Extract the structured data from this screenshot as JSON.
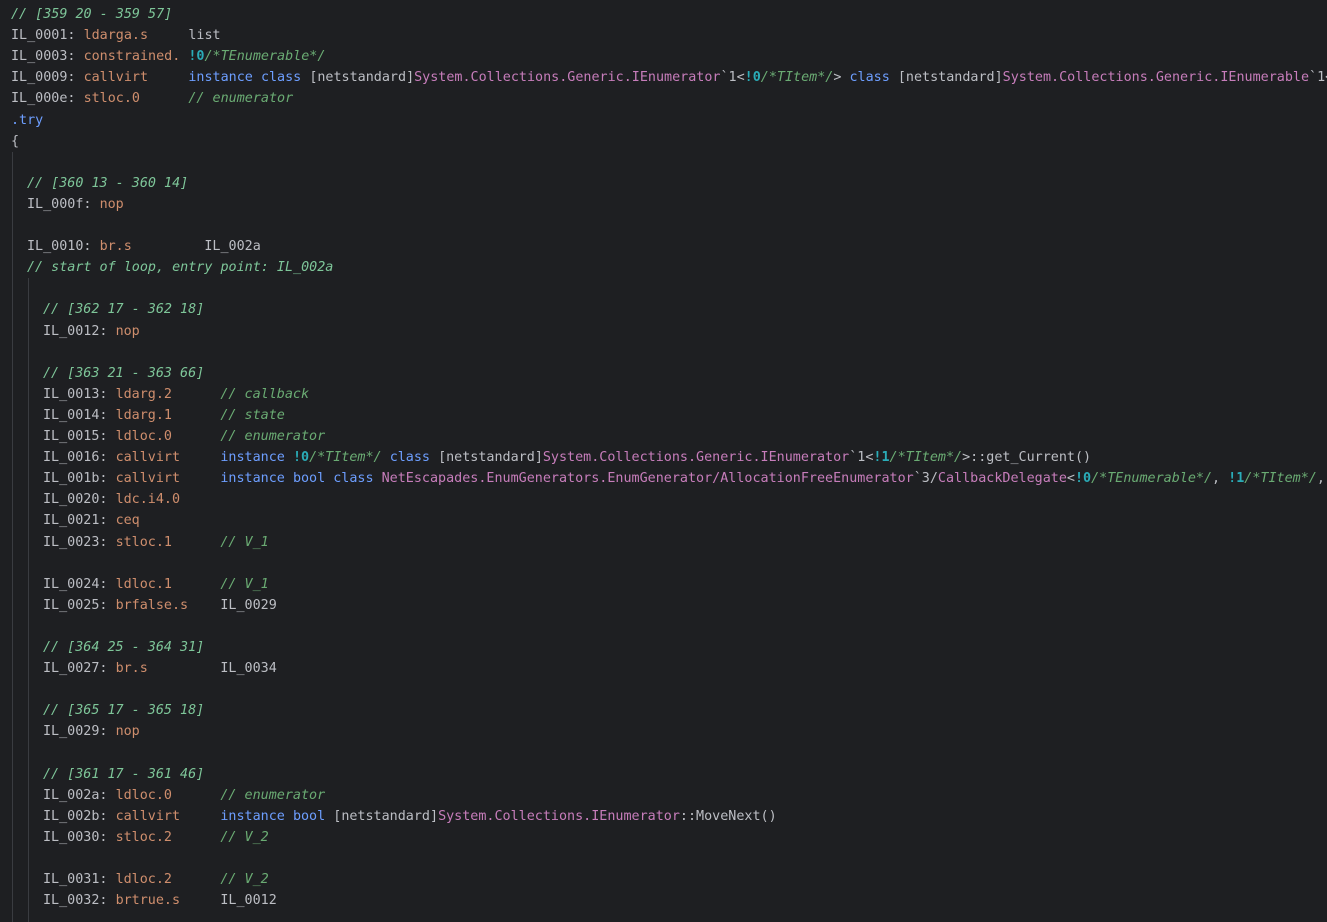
{
  "editor": {
    "lines": [
      {
        "indent": 0,
        "tokens": [
          [
            "cmtline",
            "// [359 20 - 359 57]"
          ]
        ]
      },
      {
        "indent": 0,
        "tokens": [
          [
            "label",
            "IL_0001: "
          ],
          [
            "op",
            "ldarga.s"
          ],
          [
            "plain",
            "     list"
          ]
        ]
      },
      {
        "indent": 0,
        "tokens": [
          [
            "label",
            "IL_0003: "
          ],
          [
            "op",
            "constrained."
          ],
          [
            "plain",
            " "
          ],
          [
            "num",
            "!0"
          ],
          [
            "cmt",
            "/*TEnumerable*/"
          ]
        ]
      },
      {
        "indent": 0,
        "tokens": [
          [
            "label",
            "IL_0009: "
          ],
          [
            "op",
            "callvirt"
          ],
          [
            "plain",
            "     "
          ],
          [
            "kw",
            "instance"
          ],
          [
            "plain",
            " "
          ],
          [
            "kw",
            "class"
          ],
          [
            "plain",
            " "
          ],
          [
            "bracket",
            "["
          ],
          [
            "ns",
            "netstandard"
          ],
          [
            "bracket",
            "]"
          ],
          [
            "type",
            "System.Collections.Generic.IEnumerator"
          ],
          [
            "punct",
            "`1<"
          ],
          [
            "num",
            "!0"
          ],
          [
            "cmt",
            "/*TItem*/"
          ],
          [
            "punct",
            "> "
          ],
          [
            "kw",
            "class"
          ],
          [
            "plain",
            " "
          ],
          [
            "bracket",
            "["
          ],
          [
            "ns",
            "netstandard"
          ],
          [
            "bracket",
            "]"
          ],
          [
            "type",
            "System.Collections.Generic.IEnumerable"
          ],
          [
            "punct",
            "`1<!"
          ]
        ]
      },
      {
        "indent": 0,
        "tokens": [
          [
            "label",
            "IL_000e: "
          ],
          [
            "op",
            "stloc.0"
          ],
          [
            "plain",
            "      "
          ],
          [
            "cmt",
            "// enumerator"
          ]
        ]
      },
      {
        "indent": 0,
        "tokens": [
          [
            "kw",
            ".try"
          ]
        ]
      },
      {
        "indent": 0,
        "tokens": [
          [
            "punct",
            "{"
          ]
        ]
      },
      {
        "indent": 0,
        "tokens": []
      },
      {
        "indent": 1,
        "tokens": [
          [
            "cmtline",
            "// [360 13 - 360 14]"
          ]
        ]
      },
      {
        "indent": 1,
        "tokens": [
          [
            "label",
            "IL_000f: "
          ],
          [
            "op",
            "nop"
          ]
        ]
      },
      {
        "indent": 0,
        "tokens": []
      },
      {
        "indent": 1,
        "tokens": [
          [
            "label",
            "IL_0010: "
          ],
          [
            "op",
            "br.s"
          ],
          [
            "plain",
            "         IL_002a"
          ]
        ]
      },
      {
        "indent": 1,
        "tokens": [
          [
            "cmtline",
            "// start of loop, entry point: IL_002a"
          ]
        ]
      },
      {
        "indent": 0,
        "tokens": []
      },
      {
        "indent": 2,
        "tokens": [
          [
            "cmtline",
            "// [362 17 - 362 18]"
          ]
        ]
      },
      {
        "indent": 2,
        "tokens": [
          [
            "label",
            "IL_0012: "
          ],
          [
            "op",
            "nop"
          ]
        ]
      },
      {
        "indent": 0,
        "tokens": []
      },
      {
        "indent": 2,
        "tokens": [
          [
            "cmtline",
            "// [363 21 - 363 66]"
          ]
        ]
      },
      {
        "indent": 2,
        "tokens": [
          [
            "label",
            "IL_0013: "
          ],
          [
            "op",
            "ldarg.2"
          ],
          [
            "plain",
            "      "
          ],
          [
            "cmt",
            "// callback"
          ]
        ]
      },
      {
        "indent": 2,
        "tokens": [
          [
            "label",
            "IL_0014: "
          ],
          [
            "op",
            "ldarg.1"
          ],
          [
            "plain",
            "      "
          ],
          [
            "cmt",
            "// state"
          ]
        ]
      },
      {
        "indent": 2,
        "tokens": [
          [
            "label",
            "IL_0015: "
          ],
          [
            "op",
            "ldloc.0"
          ],
          [
            "plain",
            "      "
          ],
          [
            "cmt",
            "// enumerator"
          ]
        ]
      },
      {
        "indent": 2,
        "tokens": [
          [
            "label",
            "IL_0016: "
          ],
          [
            "op",
            "callvirt"
          ],
          [
            "plain",
            "     "
          ],
          [
            "kw",
            "instance"
          ],
          [
            "plain",
            " "
          ],
          [
            "num",
            "!0"
          ],
          [
            "cmt",
            "/*TItem*/"
          ],
          [
            "plain",
            " "
          ],
          [
            "kw",
            "class"
          ],
          [
            "plain",
            " "
          ],
          [
            "bracket",
            "["
          ],
          [
            "ns",
            "netstandard"
          ],
          [
            "bracket",
            "]"
          ],
          [
            "type",
            "System.Collections.Generic.IEnumerator"
          ],
          [
            "punct",
            "`1<"
          ],
          [
            "num",
            "!1"
          ],
          [
            "cmt",
            "/*TItem*/"
          ],
          [
            "punct",
            ">::"
          ],
          [
            "method",
            "get_Current()"
          ]
        ]
      },
      {
        "indent": 2,
        "tokens": [
          [
            "label",
            "IL_001b: "
          ],
          [
            "op",
            "callvirt"
          ],
          [
            "plain",
            "     "
          ],
          [
            "kw",
            "instance"
          ],
          [
            "plain",
            " "
          ],
          [
            "kw",
            "bool"
          ],
          [
            "plain",
            " "
          ],
          [
            "kw",
            "class"
          ],
          [
            "plain",
            " "
          ],
          [
            "type",
            "NetEscapades.EnumGenerators.EnumGenerator/AllocationFreeEnumerator"
          ],
          [
            "punct",
            "`3/"
          ],
          [
            "type",
            "CallbackDelegate"
          ],
          [
            "punct",
            "<"
          ],
          [
            "num",
            "!0"
          ],
          [
            "cmt",
            "/*TEnumerable*/"
          ],
          [
            "punct",
            ", "
          ],
          [
            "num",
            "!1"
          ],
          [
            "cmt",
            "/*TItem*/"
          ],
          [
            "punct",
            ", "
          ],
          [
            "num",
            "!"
          ]
        ]
      },
      {
        "indent": 2,
        "tokens": [
          [
            "label",
            "IL_0020: "
          ],
          [
            "op",
            "ldc.i4.0"
          ]
        ]
      },
      {
        "indent": 2,
        "tokens": [
          [
            "label",
            "IL_0021: "
          ],
          [
            "op",
            "ceq"
          ]
        ]
      },
      {
        "indent": 2,
        "tokens": [
          [
            "label",
            "IL_0023: "
          ],
          [
            "op",
            "stloc.1"
          ],
          [
            "plain",
            "      "
          ],
          [
            "cmt",
            "// V_1"
          ]
        ]
      },
      {
        "indent": 0,
        "tokens": []
      },
      {
        "indent": 2,
        "tokens": [
          [
            "label",
            "IL_0024: "
          ],
          [
            "op",
            "ldloc.1"
          ],
          [
            "plain",
            "      "
          ],
          [
            "cmt",
            "// V_1"
          ]
        ]
      },
      {
        "indent": 2,
        "tokens": [
          [
            "label",
            "IL_0025: "
          ],
          [
            "op",
            "brfalse.s"
          ],
          [
            "plain",
            "    IL_0029"
          ]
        ]
      },
      {
        "indent": 0,
        "tokens": []
      },
      {
        "indent": 2,
        "tokens": [
          [
            "cmtline",
            "// [364 25 - 364 31]"
          ]
        ]
      },
      {
        "indent": 2,
        "tokens": [
          [
            "label",
            "IL_0027: "
          ],
          [
            "op",
            "br.s"
          ],
          [
            "plain",
            "         IL_0034"
          ]
        ]
      },
      {
        "indent": 0,
        "tokens": []
      },
      {
        "indent": 2,
        "tokens": [
          [
            "cmtline",
            "// [365 17 - 365 18]"
          ]
        ]
      },
      {
        "indent": 2,
        "tokens": [
          [
            "label",
            "IL_0029: "
          ],
          [
            "op",
            "nop"
          ]
        ]
      },
      {
        "indent": 0,
        "tokens": []
      },
      {
        "indent": 2,
        "tokens": [
          [
            "cmtline",
            "// [361 17 - 361 46]"
          ]
        ]
      },
      {
        "indent": 2,
        "tokens": [
          [
            "label",
            "IL_002a: "
          ],
          [
            "op",
            "ldloc.0"
          ],
          [
            "plain",
            "      "
          ],
          [
            "cmt",
            "// enumerator"
          ]
        ]
      },
      {
        "indent": 2,
        "tokens": [
          [
            "label",
            "IL_002b: "
          ],
          [
            "op",
            "callvirt"
          ],
          [
            "plain",
            "     "
          ],
          [
            "kw",
            "instance"
          ],
          [
            "plain",
            " "
          ],
          [
            "kw",
            "bool"
          ],
          [
            "plain",
            " "
          ],
          [
            "bracket",
            "["
          ],
          [
            "ns",
            "netstandard"
          ],
          [
            "bracket",
            "]"
          ],
          [
            "type",
            "System.Collections.IEnumerator"
          ],
          [
            "punct",
            "::"
          ],
          [
            "method",
            "MoveNext()"
          ]
        ]
      },
      {
        "indent": 2,
        "tokens": [
          [
            "label",
            "IL_0030: "
          ],
          [
            "op",
            "stloc.2"
          ],
          [
            "plain",
            "      "
          ],
          [
            "cmt",
            "// V_2"
          ]
        ]
      },
      {
        "indent": 0,
        "tokens": []
      },
      {
        "indent": 2,
        "tokens": [
          [
            "label",
            "IL_0031: "
          ],
          [
            "op",
            "ldloc.2"
          ],
          [
            "plain",
            "      "
          ],
          [
            "cmt",
            "// V_2"
          ]
        ]
      },
      {
        "indent": 2,
        "tokens": [
          [
            "label",
            "IL_0032: "
          ],
          [
            "op",
            "brtrue.s"
          ],
          [
            "plain",
            "     IL_0012"
          ]
        ]
      }
    ]
  }
}
